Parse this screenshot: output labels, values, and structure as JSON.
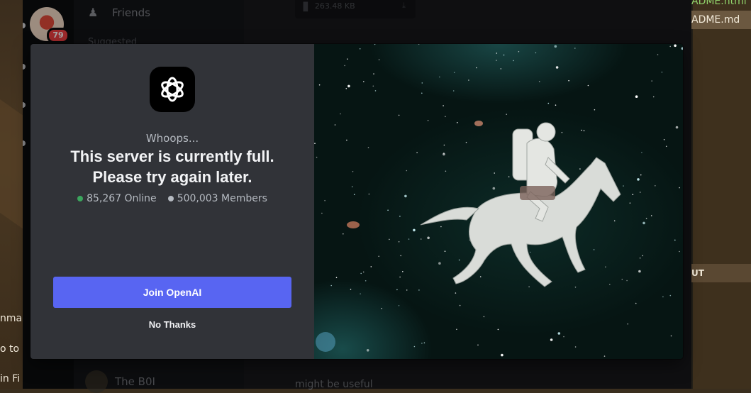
{
  "background": {
    "left_texts": [
      "nmar",
      "o to I",
      "in Fi"
    ],
    "right_panel": {
      "file_html": "ADME.html",
      "file_md": "ADME.md",
      "caption": "UT"
    }
  },
  "discord": {
    "rail_badge": "79",
    "nav_friends": "Friends",
    "nav_suggested": "Suggested",
    "dm_name": "The B0I",
    "file_size": "263.48 KB",
    "chat_snippet": "might be useful"
  },
  "modal": {
    "subtitle": "Whoops...",
    "title_line1": "This server is currently full.",
    "title_line2": "Please try again later.",
    "online_text": "85,267 Online",
    "members_text": "500,003 Members",
    "join_label": "Join OpenAI",
    "no_thanks_label": "No Thanks",
    "colors": {
      "online_dot": "#3ba55d",
      "members_dot": "#b5bac1",
      "button": "#5865f2"
    },
    "icons": {
      "server": "openai-logo-icon",
      "friends": "friends-icon",
      "file": "file-icon",
      "download": "download-icon"
    }
  }
}
